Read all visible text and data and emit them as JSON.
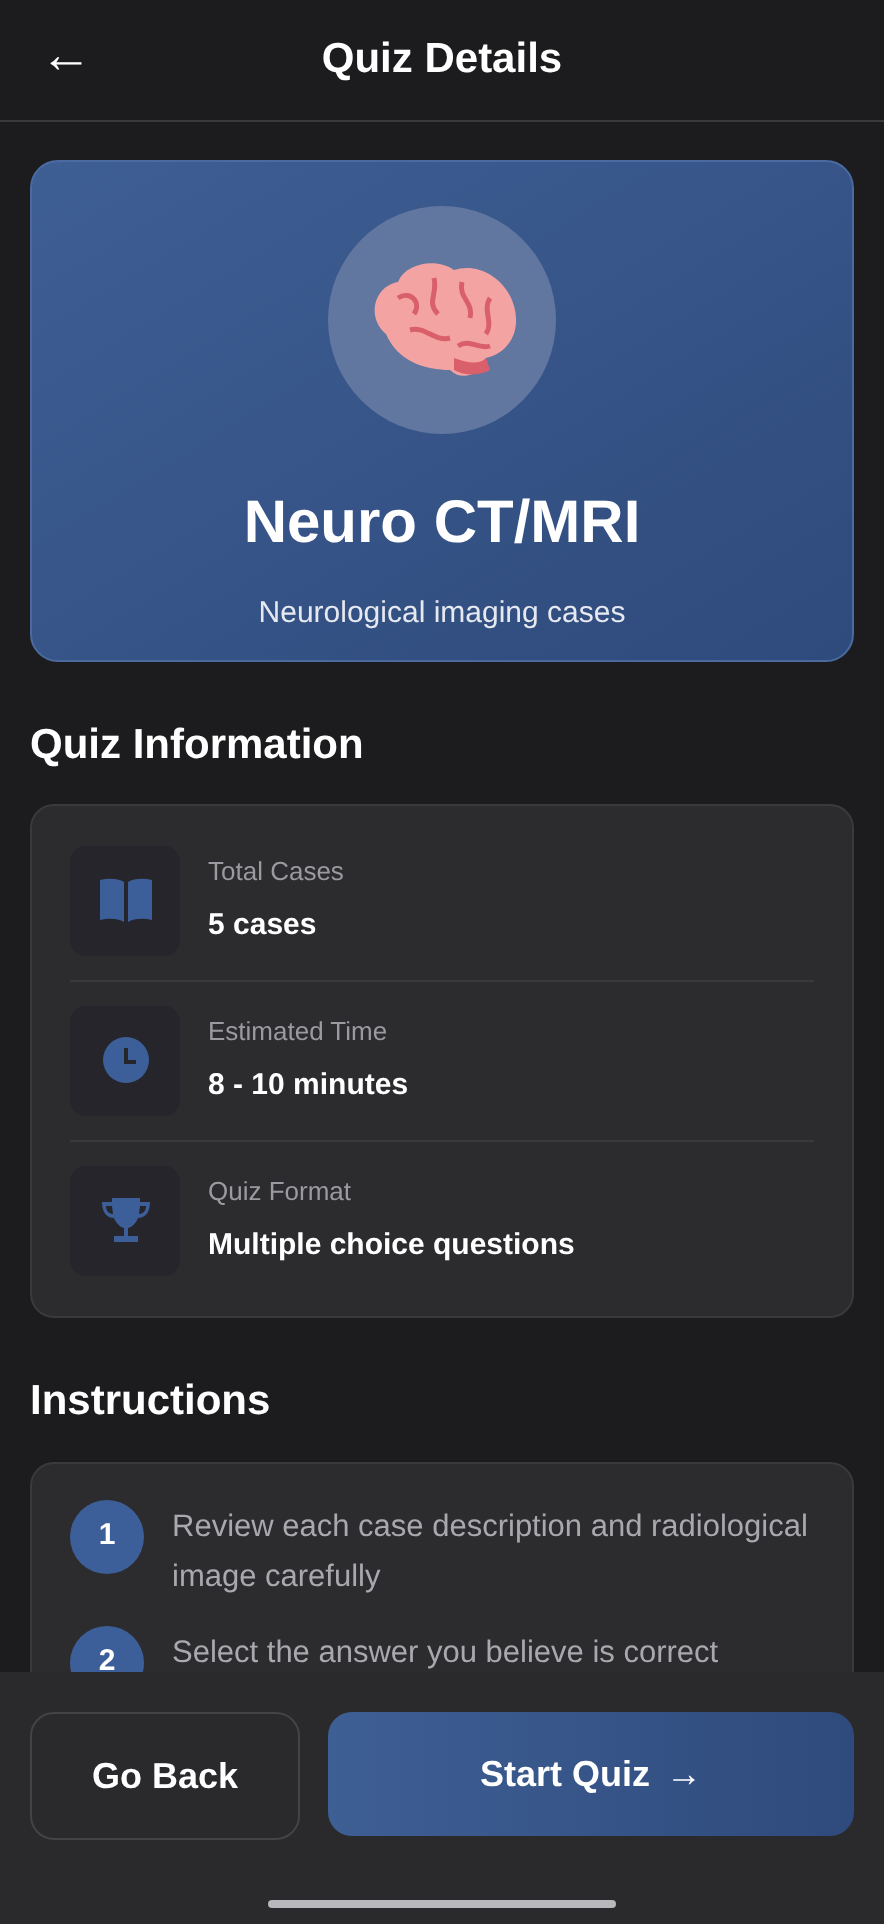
{
  "header": {
    "back": "←",
    "title": "Quiz Details"
  },
  "hero": {
    "title": "Neuro CT/MRI",
    "subtitle": "Neurological imaging cases"
  },
  "info_section": {
    "heading": "Quiz Information",
    "items": [
      {
        "kind": "book",
        "label": "Total Cases",
        "value": "5 cases"
      },
      {
        "kind": "clock",
        "label": "Estimated Time",
        "value": "8 - 10 minutes"
      },
      {
        "kind": "trophy",
        "label": "Quiz Format",
        "value": "Multiple choice questions"
      }
    ]
  },
  "instructions": {
    "heading": "Instructions",
    "steps": [
      {
        "number": "1",
        "text": "Review each case description and radiological image carefully"
      },
      {
        "number": "2",
        "text": "Select the answer you believe is correct"
      }
    ]
  },
  "actions": {
    "secondary": "Go Back",
    "primary": "Start Quiz",
    "primary_arrow": "→"
  }
}
